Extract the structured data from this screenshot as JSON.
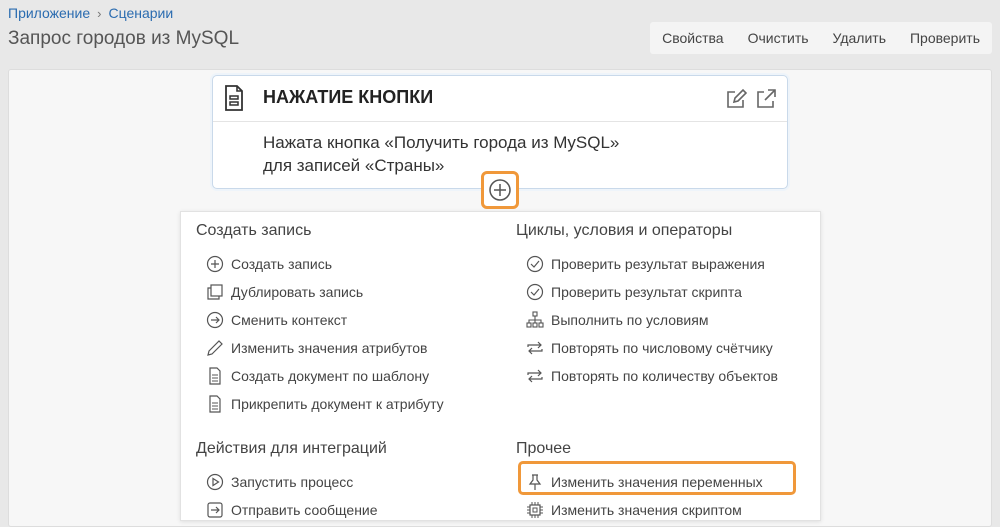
{
  "breadcrumb": {
    "app": "Приложение",
    "section": "Сценарии"
  },
  "page": {
    "title": "Запрос городов из MySQL"
  },
  "toolbar": {
    "properties": "Свойства",
    "clear": "Очистить",
    "delete": "Удалить",
    "check": "Проверить"
  },
  "event": {
    "title": "НАЖАТИЕ КНОПКИ",
    "line1": "Нажата кнопка «Получить города из MySQL»",
    "line2": "для записей «Страны»"
  },
  "menu": {
    "create": {
      "title": "Создать запись",
      "items": [
        "Создать запись",
        "Дублировать запись",
        "Сменить контекст",
        "Изменить значения атрибутов",
        "Создать документ по шаблону",
        "Прикрепить документ к атрибуту"
      ]
    },
    "loops": {
      "title": "Циклы, условия и операторы",
      "items": [
        "Проверить результат выражения",
        "Проверить результат скрипта",
        "Выполнить по условиям",
        "Повторять по числовому счётчику",
        "Повторять по количеству объектов"
      ]
    },
    "integrations": {
      "title": "Действия для интеграций",
      "items": [
        "Запустить процесс",
        "Отправить сообщение"
      ]
    },
    "other": {
      "title": "Прочее",
      "items": [
        "Изменить значения переменных",
        "Изменить значения скриптом"
      ]
    }
  },
  "colors": {
    "accent": "#f0983a",
    "link": "#2b6cb0"
  }
}
